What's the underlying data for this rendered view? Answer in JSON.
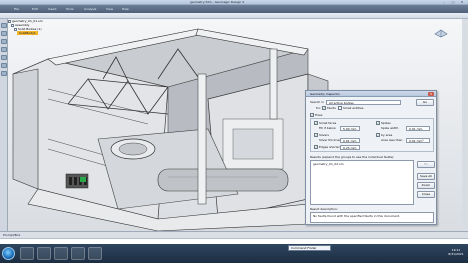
{
  "app": {
    "title": "geometry.3dm - Geomagic Design X",
    "menus": [
      "File",
      "Edit",
      "Insert",
      "Tools",
      "Analysis",
      "View",
      "Help"
    ],
    "window_buttons": [
      "–",
      "□",
      "✕"
    ]
  },
  "tree": {
    "rows": [
      "geometry_01_01.sm",
      "Assembly",
      "Solid Bodies (1)",
      "SolidBody1"
    ]
  },
  "dialog": {
    "title": "Geometry Inspector",
    "close": "✕",
    "search_in_label": "Search in",
    "search_in_value": "All active bodies",
    "search_btn": "Go",
    "faults_label": "Faults",
    "small_entities_label": "Small entities",
    "fixes_label": "Fixes",
    "small_faces_label": "Small faces",
    "fill_if_below_label": "Fill if below",
    "fill_if_below_value": "5.00 mm",
    "spikes_label": "Spikes",
    "spike_width_label": "Spike width",
    "spike_width_value": "0.01 mm",
    "slivers_label": "Slivers",
    "sliver_thickness_label": "Sliver thickness",
    "sliver_thickness_value": "0.01 mm",
    "by_area_label": "by area",
    "area_less_than_label": "Area less than",
    "area_less_than_value": "0.01 mm²",
    "edges_label": "Edges shorter than",
    "edges_value": "0.25 mm",
    "results_label": "Results (expand the groups to see the individual faults):",
    "results_item": "geometry_01_02.sm",
    "result_desc_label": "Result description:",
    "result_desc_text": "No faults found with the specified faults in this document.",
    "buttons": {
      "fix": "Fix",
      "save_all": "Save All",
      "zoom": "Zoom",
      "close": "Close"
    }
  },
  "status": {
    "prompt": "Prompt/Box",
    "taskbar_cmd": "Command Finder",
    "clock_time": "19:11",
    "clock_date": "8/31/2021"
  }
}
